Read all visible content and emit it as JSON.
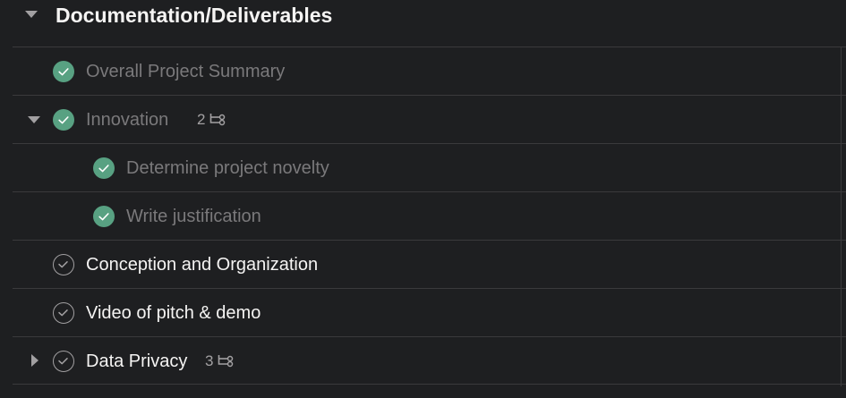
{
  "section": {
    "title": "Documentation/Deliverables"
  },
  "tasks": [
    {
      "label": "Overall Project Summary",
      "completed": true
    },
    {
      "label": "Innovation",
      "completed": true,
      "subtask_count": "2",
      "expanded": true
    },
    {
      "label": "Determine project novelty",
      "completed": true,
      "subtask": true
    },
    {
      "label": "Write justification",
      "completed": true,
      "subtask": true
    },
    {
      "label": "Conception and Organization",
      "completed": false
    },
    {
      "label": "Video of pitch & demo",
      "completed": false
    },
    {
      "label": "Data Privacy",
      "completed": false,
      "subtask_count": "3",
      "expanded": false
    }
  ],
  "colors": {
    "background": "#1e1f21",
    "complete_green": "#58a182",
    "divider": "#3a3a3c",
    "text_primary": "#f5f4f3",
    "text_completed": "#7a797b",
    "icon_gray": "#a2a0a2"
  },
  "icons": {
    "section_toggle": "caret-down-icon",
    "complete": "check-circle-filled-icon",
    "incomplete": "check-circle-outline-icon",
    "subtasks": "subtask-icon"
  }
}
